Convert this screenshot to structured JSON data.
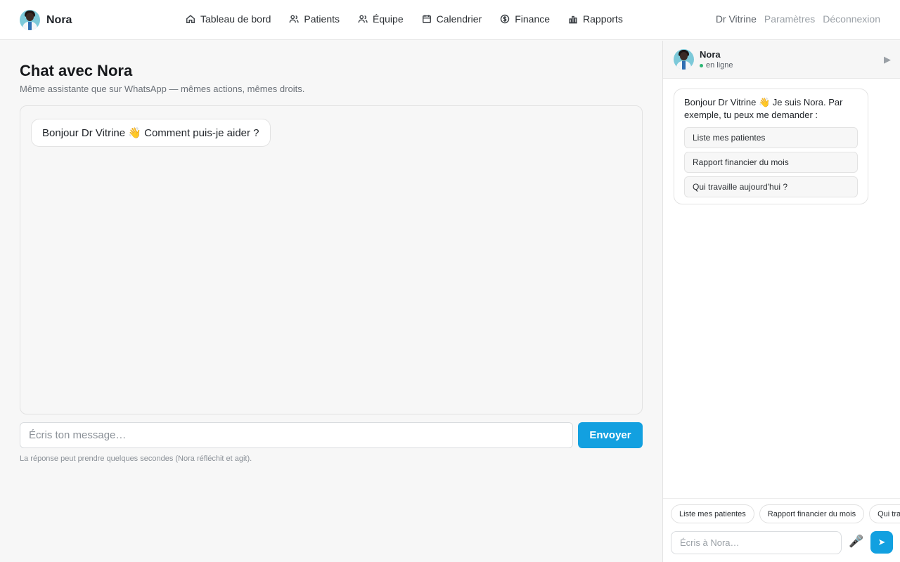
{
  "header": {
    "brand": "Nora",
    "nav": [
      {
        "label": "Tableau de bord",
        "icon": "home-icon"
      },
      {
        "label": "Patients",
        "icon": "users-icon"
      },
      {
        "label": "Équipe",
        "icon": "team-icon"
      },
      {
        "label": "Calendrier",
        "icon": "calendar-icon"
      },
      {
        "label": "Finance",
        "icon": "dollar-icon"
      },
      {
        "label": "Rapports",
        "icon": "bar-chart-icon"
      }
    ],
    "user": "Dr Vitrine",
    "settings": "Paramètres",
    "logout": "Déconnexion"
  },
  "main": {
    "title": "Chat avec Nora",
    "subtitle": "Même assistante que sur WhatsApp — mêmes actions, mêmes droits.",
    "greeting": "Bonjour Dr Vitrine 👋 Comment puis-je aider ?",
    "input_placeholder": "Écris ton message…",
    "send_label": "Envoyer",
    "hint": "La réponse peut prendre quelques secondes (Nora réfléchit et agit)."
  },
  "side": {
    "name": "Nora",
    "status": "en ligne",
    "intro": "Bonjour Dr Vitrine 👋 Je suis Nora. Par exemple, tu peux me demander :",
    "suggestions": [
      "Liste mes patientes",
      "Rapport financier du mois",
      "Qui travaille aujourd'hui ?"
    ],
    "chips": [
      "Liste mes patientes",
      "Rapport financier du mois",
      "Qui travaille aujourd'hui ?"
    ],
    "input_placeholder": "Écris à Nora…"
  },
  "colors": {
    "accent": "#12a0e0",
    "online": "#2bb673"
  }
}
